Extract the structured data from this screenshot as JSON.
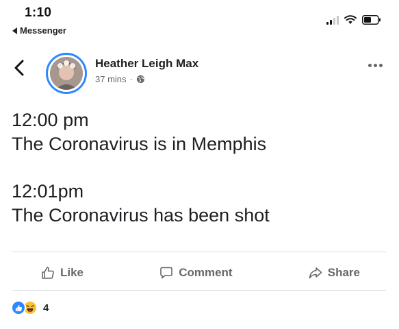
{
  "status_bar": {
    "time": "1:10",
    "back_app_label": "Messenger"
  },
  "post": {
    "author": "Heather Leigh Max",
    "timestamp": "37 mins",
    "separator": "·",
    "audience_icon": "globe-icon",
    "lines": [
      "12:00 pm",
      "The Coronavirus is in Memphis",
      "12:01pm",
      "The Coronavirus has been shot"
    ]
  },
  "actions": {
    "like": "Like",
    "comment": "Comment",
    "share": "Share"
  },
  "reactions": {
    "count": "4",
    "types": [
      "like-reaction-icon",
      "haha-reaction-icon"
    ]
  },
  "colors": {
    "accent": "#2d88ff",
    "secondary_text": "#65676b",
    "primary_text": "#1c1e21",
    "haha": "#f7c22d"
  }
}
